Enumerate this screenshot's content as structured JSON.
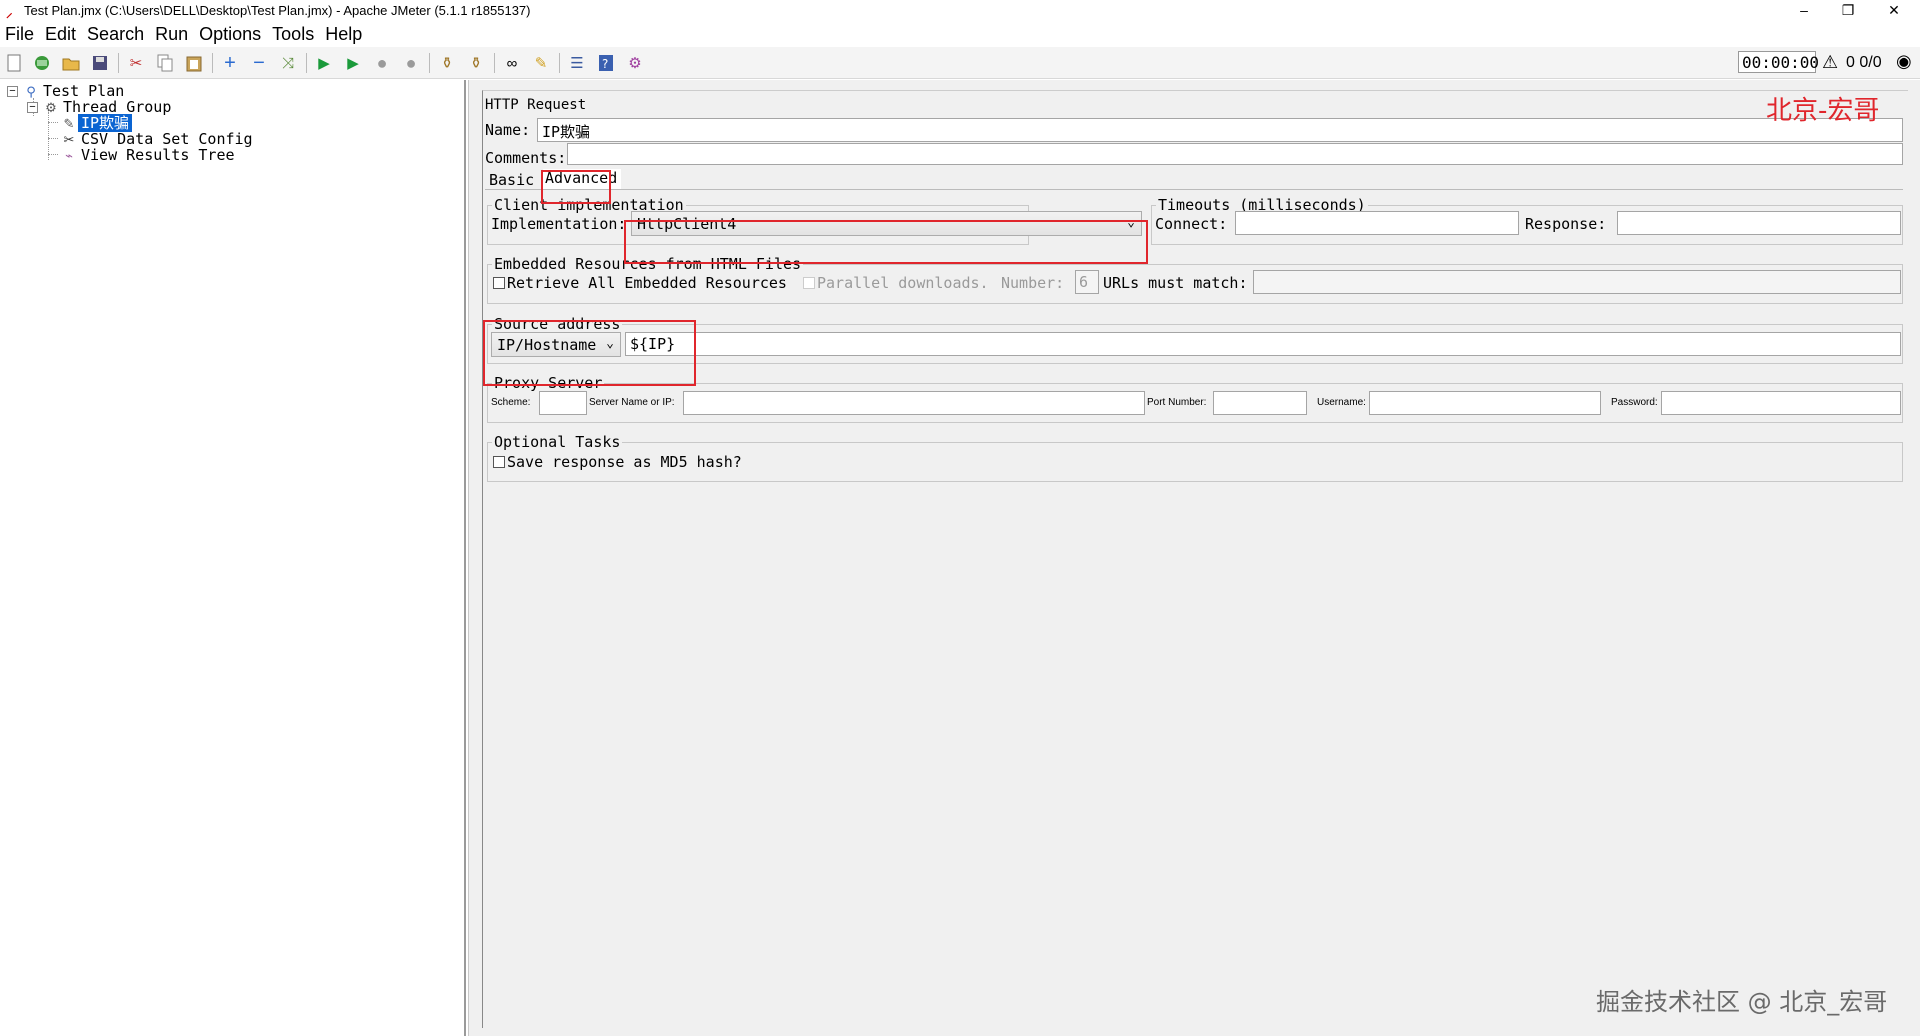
{
  "window": {
    "title": "Test Plan.jmx (C:\\Users\\DELL\\Desktop\\Test Plan.jmx) - Apache JMeter (5.1.1 r1855137)",
    "minimize": "–",
    "restore": "❐",
    "close": "✕"
  },
  "menu": [
    "File",
    "Edit",
    "Search",
    "Run",
    "Options",
    "Tools",
    "Help"
  ],
  "toolbar": {
    "icons": [
      "new-icon",
      "templates-icon",
      "open-icon",
      "save-icon",
      "cut-icon",
      "copy-icon",
      "paste-icon",
      "expand-icon",
      "collapse-icon",
      "toggle-icon",
      "start-icon",
      "start-no-pauses-icon",
      "stop-icon",
      "shutdown-icon",
      "clear-icon",
      "clear-all-icon",
      "search-icon",
      "reset-search-icon",
      "function-helper-icon",
      "help-icon",
      "remote-icon"
    ],
    "timer": "00:00:00",
    "counts": "0  0/0"
  },
  "tree": {
    "items": [
      {
        "label": "Test Plan",
        "icon": "test-plan-icon"
      },
      {
        "label": "Thread Group",
        "icon": "thread-group-icon"
      },
      {
        "label": "IP欺骗",
        "icon": "http-request-icon"
      },
      {
        "label": "CSV Data Set Config",
        "icon": "csv-config-icon"
      },
      {
        "label": "View Results Tree",
        "icon": "results-tree-icon"
      }
    ]
  },
  "form": {
    "heading": "HTTP Request",
    "name_label": "Name:",
    "name_value": "IP欺骗",
    "comments_label": "Comments:",
    "tabs": [
      "Basic",
      "Advanced"
    ],
    "client_impl": {
      "title": "Client implementation",
      "impl_label": "Implementation:",
      "impl_value": "HttpClient4"
    },
    "timeouts": {
      "title": "Timeouts (milliseconds)",
      "connect_label": "Connect:",
      "response_label": "Response:"
    },
    "embedded": {
      "title": "Embedded Resources from HTML Files",
      "retrieve_label": "Retrieve All Embedded Resources",
      "parallel_label": "Parallel downloads.",
      "number_label": "Number:",
      "number_value": "6",
      "urls_label": "URLs must match:"
    },
    "source": {
      "title": "Source address",
      "type_value": "IP/Hostname",
      "address_value": "${IP}"
    },
    "proxy": {
      "title": "Proxy Server",
      "scheme_label": "Scheme:",
      "server_label": "Server Name or IP:",
      "port_label": "Port Number:",
      "username_label": "Username:",
      "password_label": "Password:"
    },
    "optional": {
      "title": "Optional Tasks",
      "md5_label": "Save response as MD5 hash?"
    }
  },
  "brand_top": "北京-宏哥",
  "watermark": "掘金技术社区 @ 北京_宏哥",
  "colors": {
    "highlight": "#e0262c",
    "selection": "#0a64d2"
  }
}
